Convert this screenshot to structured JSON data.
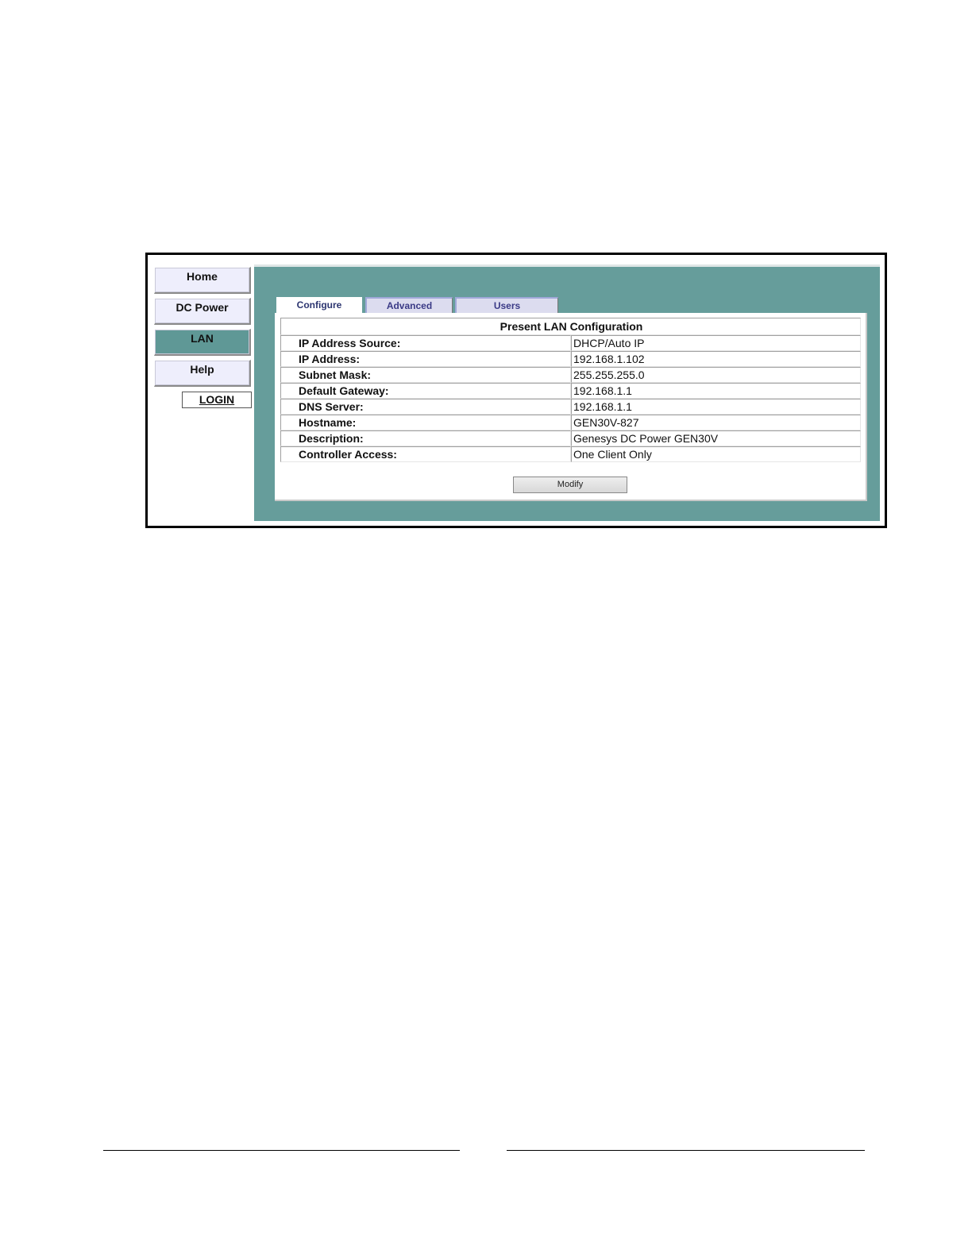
{
  "sidebar": {
    "items": [
      {
        "label": "Home"
      },
      {
        "label": "DC Power"
      },
      {
        "label": "LAN",
        "active": true
      },
      {
        "label": "Help"
      }
    ],
    "login_label": "LOGIN"
  },
  "tabs": [
    {
      "label": "Configure",
      "active": true
    },
    {
      "label": "Advanced"
    },
    {
      "label": "Users"
    }
  ],
  "config": {
    "title": "Present LAN Configuration",
    "rows": [
      {
        "label": "IP Address Source:",
        "value": "DHCP/Auto IP"
      },
      {
        "label": "IP Address:",
        "value": "192.168.1.102"
      },
      {
        "label": "Subnet Mask:",
        "value": "255.255.255.0"
      },
      {
        "label": "Default Gateway:",
        "value": "192.168.1.1"
      },
      {
        "label": "DNS Server:",
        "value": "192.168.1.1"
      },
      {
        "label": "Hostname:",
        "value": "GEN30V-827"
      },
      {
        "label": "Description:",
        "value": "Genesys DC Power GEN30V"
      },
      {
        "label": "Controller Access:",
        "value": "One Client Only"
      }
    ],
    "modify_label": "Modify"
  },
  "colors": {
    "content_bg": "#669d9b",
    "nav_active": "#5f9896",
    "nav_bg": "#eeeefc",
    "tab_text": "#3a3a86"
  }
}
